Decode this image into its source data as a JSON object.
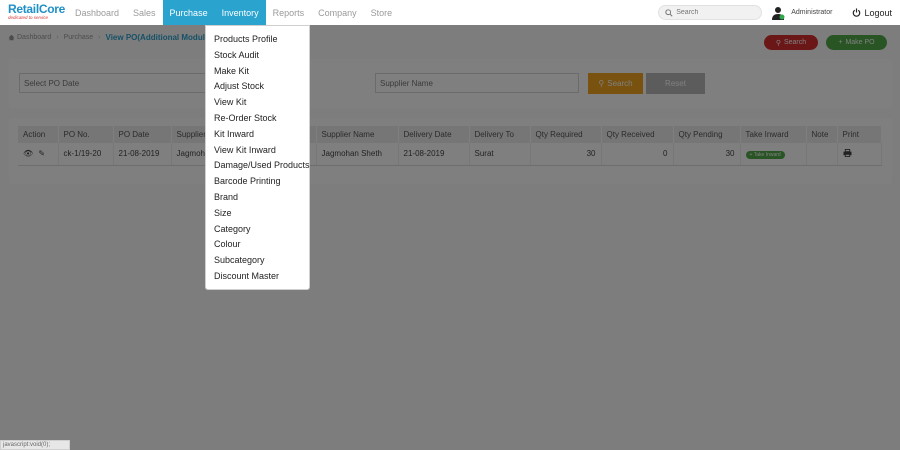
{
  "brand": {
    "name": "RetailCore",
    "tagline": "dedicated to service"
  },
  "nav": {
    "items": [
      {
        "label": "Dashboard",
        "active": false
      },
      {
        "label": "Sales",
        "active": false
      },
      {
        "label": "Purchase",
        "active": true
      },
      {
        "label": "Inventory",
        "active": true
      },
      {
        "label": "Reports",
        "active": false
      },
      {
        "label": "Company",
        "active": false
      },
      {
        "label": "Store",
        "active": false
      }
    ],
    "search_placeholder": "Search",
    "user": "Administrator",
    "logout": "Logout"
  },
  "breadcrumb": {
    "home": "Dashboard",
    "section": "Purchase",
    "current": "View PO(Additional Module)"
  },
  "actions": {
    "search": "Search",
    "make_po": "Make PO"
  },
  "filters": {
    "po_date_placeholder": "Select PO Date",
    "supplier_placeholder": "Supplier Name",
    "search": "Search",
    "reset": "Reset"
  },
  "table": {
    "headers": [
      "Action",
      "PO No.",
      "PO Date",
      "Supplier",
      "Supplier Name",
      "Delivery Date",
      "Delivery To",
      "Qty Required",
      "Qty Received",
      "Qty Pending",
      "Take Inward",
      "Note",
      "Print"
    ],
    "rows": [
      {
        "po_no": "ck-1/19-20",
        "po_date": "21-08-2019",
        "supplier": "Jagmoh",
        "supplier_name": "Jagmohan Sheth",
        "delivery_date": "21-08-2019",
        "delivery_to": "Surat",
        "qty_required": "30",
        "qty_received": "0",
        "qty_pending": "30",
        "take_inward": "Take Inward"
      }
    ]
  },
  "inventory_menu": {
    "items": [
      "Products Profile",
      "Stock Audit",
      "Make Kit",
      "Adjust Stock",
      "View Kit",
      "Re-Order Stock",
      "Kit Inward",
      "View Kit Inward",
      "Damage/Used Products",
      "Barcode Printing",
      "Brand",
      "Size",
      "Category",
      "Colour",
      "Subcategory",
      "Discount Master"
    ]
  },
  "status_bar": "javascript:void(0);",
  "colors": {
    "accent": "#2aa3cf",
    "danger": "#d72e2e",
    "success": "#52a848",
    "warning": "#f0a51d"
  }
}
